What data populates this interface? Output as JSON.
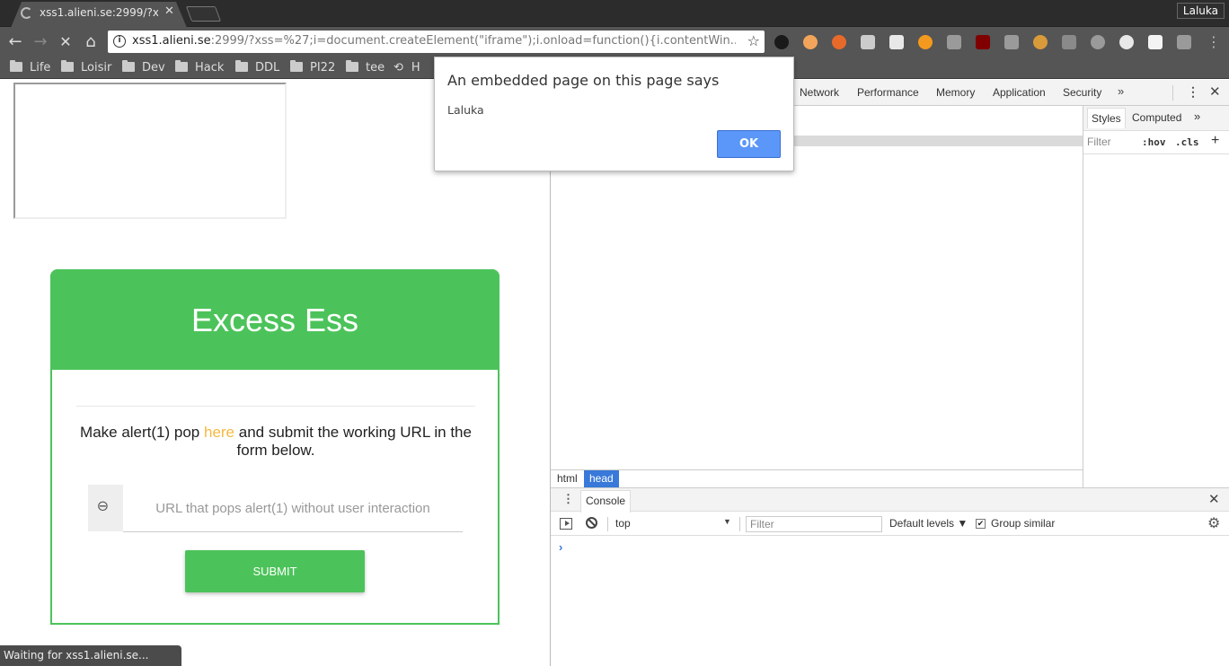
{
  "browser": {
    "tab": {
      "title_main": "xss1.alieni.se:2999/?x",
      "title_fade": "s",
      "close_glyph": "✕"
    },
    "profile_name": "Laluka",
    "nav": {
      "back_glyph": "←",
      "forward_glyph": "→",
      "stop_glyph": "✕",
      "home_glyph": "⌂"
    },
    "address": {
      "host": "xss1.alieni.se",
      "rest": ":2999/?xss=%27;i=document.createElement(\"iframe\");i.onload=function(){i.contentWin...",
      "info_glyph": "i",
      "star_glyph": "☆"
    },
    "extensions": [
      {
        "name": "off-extension-icon",
        "color": "#1a1a1a"
      },
      {
        "name": "timer-extension-icon",
        "color": "#f2a55a"
      },
      {
        "name": "fire-extension-icon",
        "color": "#e86a2a"
      },
      {
        "name": "screenshot-extension-icon",
        "color": "#cccccc"
      },
      {
        "name": "wappalyzer-extension-icon",
        "color": "#e8e8e8"
      },
      {
        "name": "play-extension-icon",
        "color": "#f39a1e"
      },
      {
        "name": "s-extension-icon",
        "color": "#9a9a9a"
      },
      {
        "name": "ublock-extension-icon",
        "color": "#800000"
      },
      {
        "name": "keyboard-extension-icon",
        "color": "#9a9a9a"
      },
      {
        "name": "cookie-extension-icon",
        "color": "#d99a3a"
      },
      {
        "name": "tc-extension-icon",
        "color": "#8a8a8a"
      },
      {
        "name": "crosshair-extension-icon",
        "color": "#9a9a9a"
      },
      {
        "name": "flickr-extension-icon",
        "color": "#e8e8e8"
      },
      {
        "name": "wikipedia-extension-icon",
        "color": "#f4f4f4"
      },
      {
        "name": "chat-extension-icon",
        "color": "#9a9a9a"
      }
    ],
    "menu_glyph": "⋮",
    "bookmarks": [
      "Life",
      "Loisir",
      "Dev",
      "Hack",
      "DDL",
      "PI22",
      "tee"
    ],
    "history_item": "H",
    "status_text": "Waiting for xss1.alieni.se..."
  },
  "page": {
    "title": "Excess Ess",
    "instruction_before": "Make alert(1) pop ",
    "instruction_link": "here",
    "instruction_after": " and submit the working URL in the form below.",
    "input_placeholder": "URL that pops alert(1) without user interaction",
    "input_value": "",
    "submit_label": "SUBMIT",
    "accent_color": "#4cc35a",
    "link_color": "#f5b942"
  },
  "devtools": {
    "tabs": [
      "Network",
      "Performance",
      "Memory",
      "Application",
      "Security"
    ],
    "more_glyph": "»",
    "crumbs": [
      "html",
      "head"
    ],
    "styles_tabs": [
      "Styles",
      "Computed"
    ],
    "styles_filter": "Filter",
    "hov": ":hov",
    "cls": ".cls",
    "plus": "+",
    "console_tab": "Console",
    "context": "top",
    "filter_placeholder": "Filter",
    "levels": "Default levels ▼",
    "group_similar": "Group similar",
    "group_similar_checked": true,
    "prompt": "›"
  },
  "dialog": {
    "title": "An embedded page on this page says",
    "message": "Laluka",
    "ok_label": "OK"
  }
}
